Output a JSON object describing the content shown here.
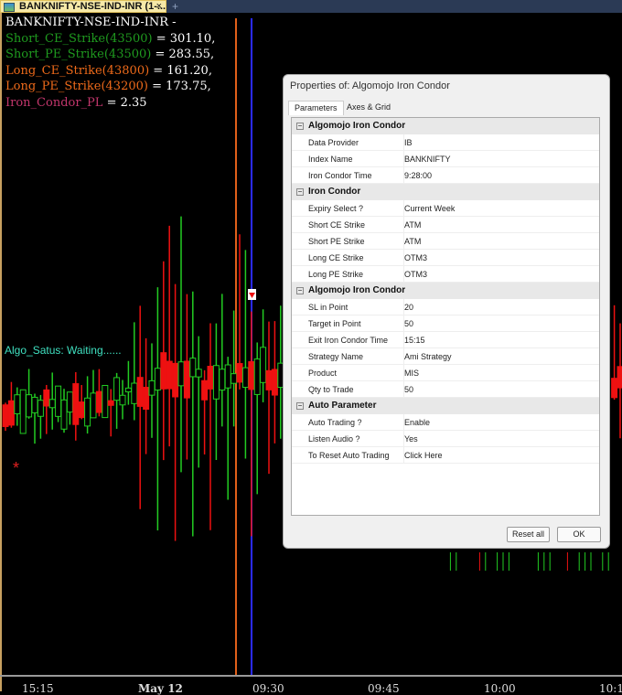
{
  "tab": {
    "title": "BANKNIFTY-NSE-IND-INR (1-...",
    "close": "×",
    "new_tab": "+"
  },
  "chart": {
    "symbol": "BANKNIFTY-NSE-IND-INR -",
    "short_ce_label": "Short_CE_Strike(43500)",
    "short_ce_value": " = 301.10,",
    "short_pe_label": "Short_PE_Strike(43500)",
    "short_pe_value": " = 283.55,",
    "long_ce_label": "Long_CE_Strike(43800)",
    "long_ce_value": " = 161.20,",
    "long_pe_label": "Long_PE_Strike(43200)",
    "long_pe_value": " = 173.75,",
    "pl_label": "Iron_Condor_PL",
    "pl_value": " = 2.35",
    "status": "Algo_Satus: Waiting......",
    "star": "*",
    "x_ticks": [
      "15:15",
      "May 12",
      "09:30",
      "09:45",
      "10:00",
      "10:1"
    ],
    "colors": {
      "up": "#22cc22",
      "down": "#ee1111",
      "orange_line": "#e0601a",
      "blue_line": "#2a2aff"
    }
  },
  "dialog": {
    "title": "Properties of: Algomojo Iron Condor",
    "tabs": [
      "Parameters",
      "Axes & Grid"
    ],
    "sections": [
      {
        "name": "Algomojo Iron Condor",
        "rows": [
          [
            "Data Provider",
            "IB"
          ],
          [
            "Index Name",
            "BANKNIFTY"
          ],
          [
            "Iron Condor Time",
            "9:28:00"
          ]
        ]
      },
      {
        "name": "Iron Condor",
        "rows": [
          [
            "Expiry Select ?",
            "Current Week"
          ],
          [
            "Short CE Strike",
            "ATM"
          ],
          [
            "Short PE Strike",
            "ATM"
          ],
          [
            "Long CE Strike",
            "OTM3"
          ],
          [
            "Long PE Strike",
            "OTM3"
          ]
        ]
      },
      {
        "name": "Algomojo Iron Condor",
        "rows": [
          [
            "SL in Point",
            "20"
          ],
          [
            "Target in Point",
            "50"
          ],
          [
            "Exit Iron Condor Time",
            "15:15"
          ],
          [
            "Strategy Name",
            "Ami Strategy"
          ],
          [
            "Product",
            "MIS"
          ],
          [
            "Qty to Trade",
            "50"
          ]
        ]
      },
      {
        "name": "Auto Parameter",
        "rows": [
          [
            "Auto Trading ?",
            "Enable"
          ],
          [
            "Listen Audio ?",
            "Yes"
          ],
          [
            "To Reset Auto Trading",
            "Click Here"
          ]
        ]
      }
    ],
    "reset_label": "Reset all",
    "ok_label": "OK"
  }
}
